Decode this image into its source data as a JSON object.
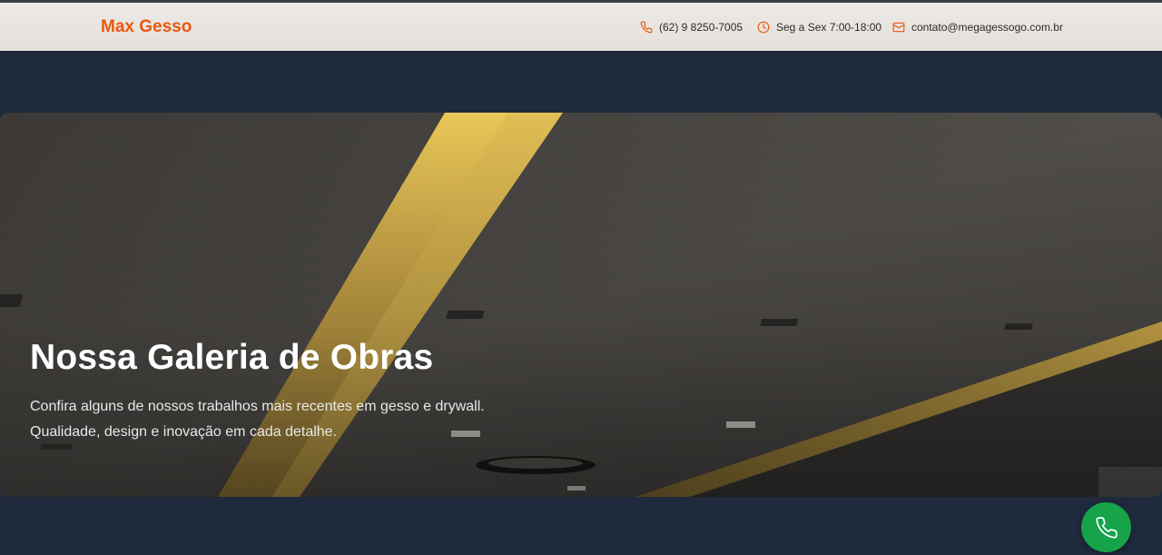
{
  "header": {
    "brand": "Max Gesso",
    "phone": "(62) 9 8250-7005",
    "hours": "Seg a Sex 7:00-18:00",
    "email": "contato@megagessogo.com.br",
    "icons": {
      "phone": "phone-icon",
      "hours": "clock-icon",
      "email": "mail-icon"
    },
    "accent_color": "#ea580c"
  },
  "hero": {
    "title": "Nossa Galeria de Obras",
    "subtitle_line1": "Confira alguns de nossos trabalhos mais recentes em gesso e drywall.",
    "subtitle_line2": "Qualidade, design e inovação em cada detalhe."
  },
  "floating_button": {
    "icon": "phone-icon",
    "color": "#16a34a"
  },
  "colors": {
    "page_background": "#1f2a3c",
    "header_background": "#ece9e6"
  }
}
